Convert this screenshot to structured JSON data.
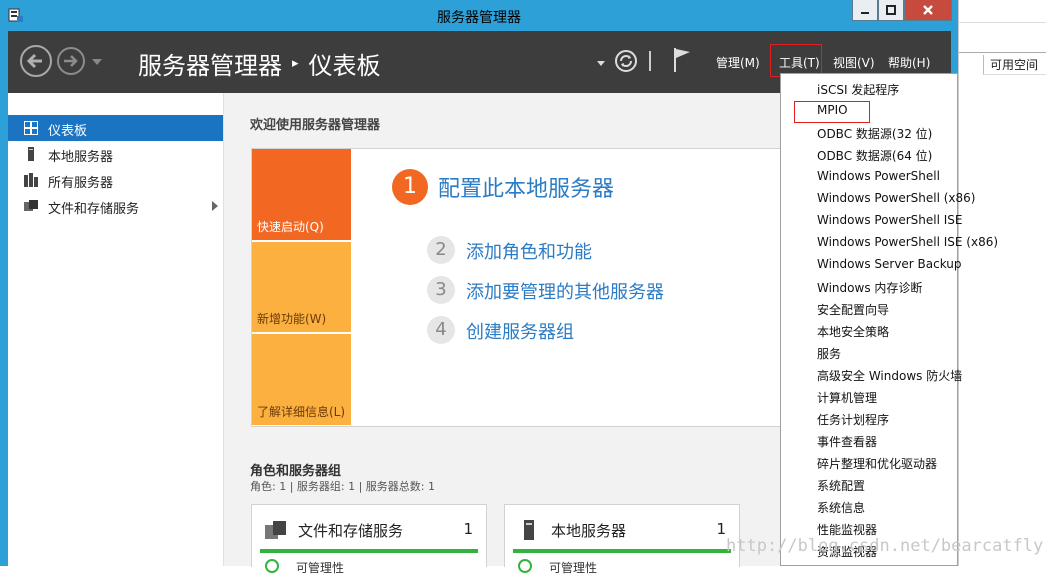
{
  "window": {
    "title": "服务器管理器"
  },
  "header": {
    "breadcrumb_root": "服务器管理器",
    "breadcrumb_sep": "▸",
    "breadcrumb_page": "仪表板",
    "menus": [
      "管理(M)",
      "工具(T)",
      "视图(V)",
      "帮助(H)"
    ]
  },
  "sidebar": {
    "items": [
      {
        "label": "仪表板",
        "icon": "dashboard-icon",
        "selected": true
      },
      {
        "label": "本地服务器",
        "icon": "server-icon"
      },
      {
        "label": "所有服务器",
        "icon": "servers-icon"
      },
      {
        "label": "文件和存储服务",
        "icon": "storage-icon"
      }
    ]
  },
  "main": {
    "welcome": "欢迎使用服务器管理器",
    "tiles": [
      "快速启动(Q)",
      "新增功能(W)",
      "了解详细信息(L)"
    ],
    "steps": [
      {
        "num": "1",
        "text": "配置此本地服务器"
      },
      {
        "num": "2",
        "text": "添加角色和功能"
      },
      {
        "num": "3",
        "text": "添加要管理的其他服务器"
      },
      {
        "num": "4",
        "text": "创建服务器组"
      }
    ],
    "roles_title": "角色和服务器组",
    "roles_sub": "角色: 1 | 服务器组: 1 | 服务器总数: 1",
    "cards": [
      {
        "title": "文件和存储服务",
        "count": "1",
        "status": "可管理性"
      },
      {
        "title": "本地服务器",
        "count": "1",
        "status": "可管理性"
      }
    ]
  },
  "background_window": {
    "column_header": "可用空间"
  },
  "tools_menu": {
    "items": [
      "iSCSI 发起程序",
      "MPIO",
      "ODBC 数据源(32 位)",
      "ODBC 数据源(64 位)",
      "Windows PowerShell",
      "Windows PowerShell (x86)",
      "Windows PowerShell ISE",
      "Windows PowerShell ISE (x86)",
      "Windows Server Backup",
      "Windows 内存诊断",
      "安全配置向导",
      "本地安全策略",
      "服务",
      "高级安全 Windows 防火墙",
      "计算机管理",
      "任务计划程序",
      "事件查看器",
      "碎片整理和优化驱动器",
      "系统配置",
      "系统信息",
      "性能监视器",
      "资源监视器"
    ]
  },
  "watermark": "http://blog.csdn.net/bearcatfly",
  "colors": {
    "accent": "#f26722",
    "tile": "#fbb040",
    "selection": "#1a74c2",
    "header": "#3d3d3d",
    "frame": "#2ea0d8",
    "status_ok": "#33b33d",
    "annotation": "#e02020"
  }
}
